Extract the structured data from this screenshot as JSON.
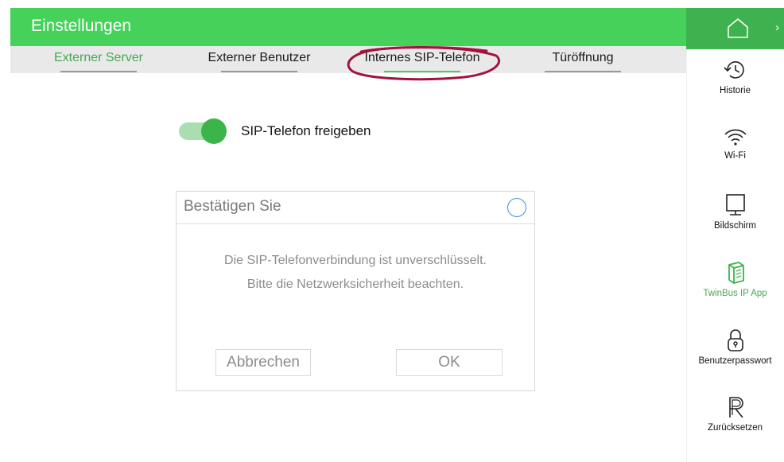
{
  "header": {
    "title": "Einstellungen"
  },
  "tabs": [
    {
      "label": "Externer Server"
    },
    {
      "label": "Externer Benutzer"
    },
    {
      "label": "Internes SIP-Telefon"
    },
    {
      "label": "Türöffnung"
    }
  ],
  "sip": {
    "toggle_label": "SIP-Telefon freigeben",
    "enabled": true
  },
  "dialog": {
    "title": "Bestätigen Sie",
    "message_line1": "Die SIP-Telefonverbindung ist unverschlüsselt.",
    "message_line2": "Bitte die Netzwerksicherheit beachten.",
    "cancel_label": "Abbrechen",
    "ok_label": "OK"
  },
  "sidebar": {
    "home_icon": "home-icon",
    "expand_glyph": "›",
    "items": [
      {
        "label": "Historie",
        "icon": "history-icon"
      },
      {
        "label": "Wi-Fi",
        "icon": "wifi-icon"
      },
      {
        "label": "Bildschirm",
        "icon": "screen-icon"
      },
      {
        "label": "TwinBus IP App",
        "icon": "app-icon"
      },
      {
        "label": "Benutzerpasswort",
        "icon": "lock-icon"
      },
      {
        "label": "Zurücksetzen",
        "icon": "reset-icon"
      }
    ]
  },
  "colors": {
    "accent": "#45d15a",
    "accent_dark": "#3eb24e",
    "annotation": "#a0153e",
    "dialog_close": "#3d8fe0"
  }
}
